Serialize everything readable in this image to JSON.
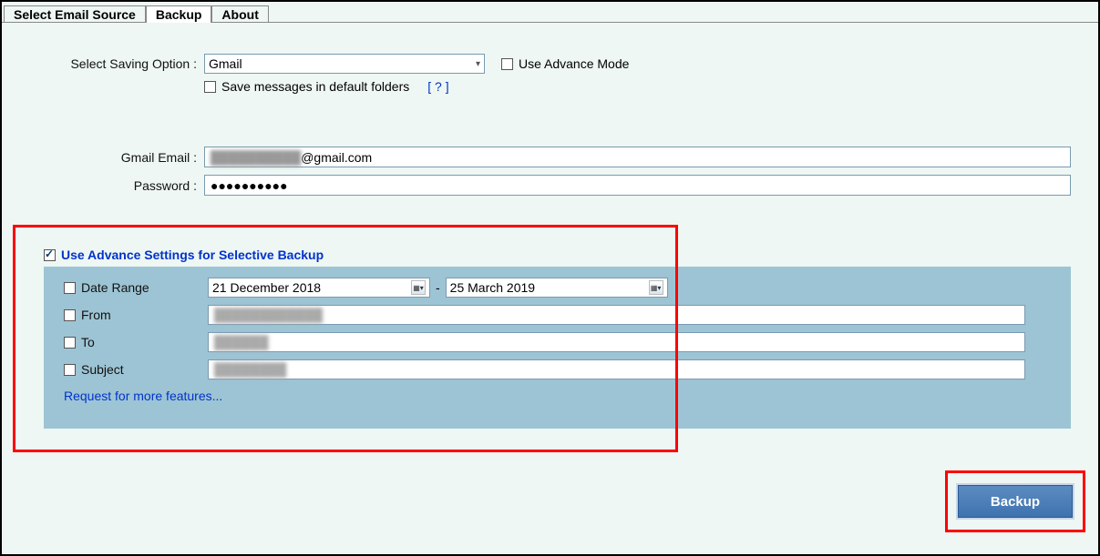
{
  "tabs": {
    "t0": "Select Email Source",
    "t1": "Backup",
    "t2": "About",
    "activeIndex": 1
  },
  "saving": {
    "label": "Select Saving Option :",
    "selected": "Gmail",
    "advModeLabel": "Use Advance Mode",
    "advModeChecked": false,
    "defaultFoldersLabel": "Save messages in default folders",
    "defaultFoldersChecked": false,
    "helpText": "[ ? ]"
  },
  "creds": {
    "emailLabel": "Gmail Email :",
    "emailMasked": "██████████",
    "emailSuffix": "@gmail.com",
    "passwordLabel": "Password :",
    "passwordMasked": "●●●●●●●●●●"
  },
  "advance": {
    "headingLabel": "Use Advance Settings for Selective Backup",
    "headingChecked": true,
    "dateRange": {
      "label": "Date Range",
      "checked": false,
      "from": "21  December  2018",
      "to": "25    March    2019"
    },
    "from": {
      "label": "From",
      "checked": false,
      "value": "████████████"
    },
    "to": {
      "label": "To",
      "checked": false,
      "value": "██████"
    },
    "subject": {
      "label": "Subject",
      "checked": false,
      "value": "████████"
    },
    "moreFeaturesLink": "Request for more features..."
  },
  "backupButton": "Backup"
}
